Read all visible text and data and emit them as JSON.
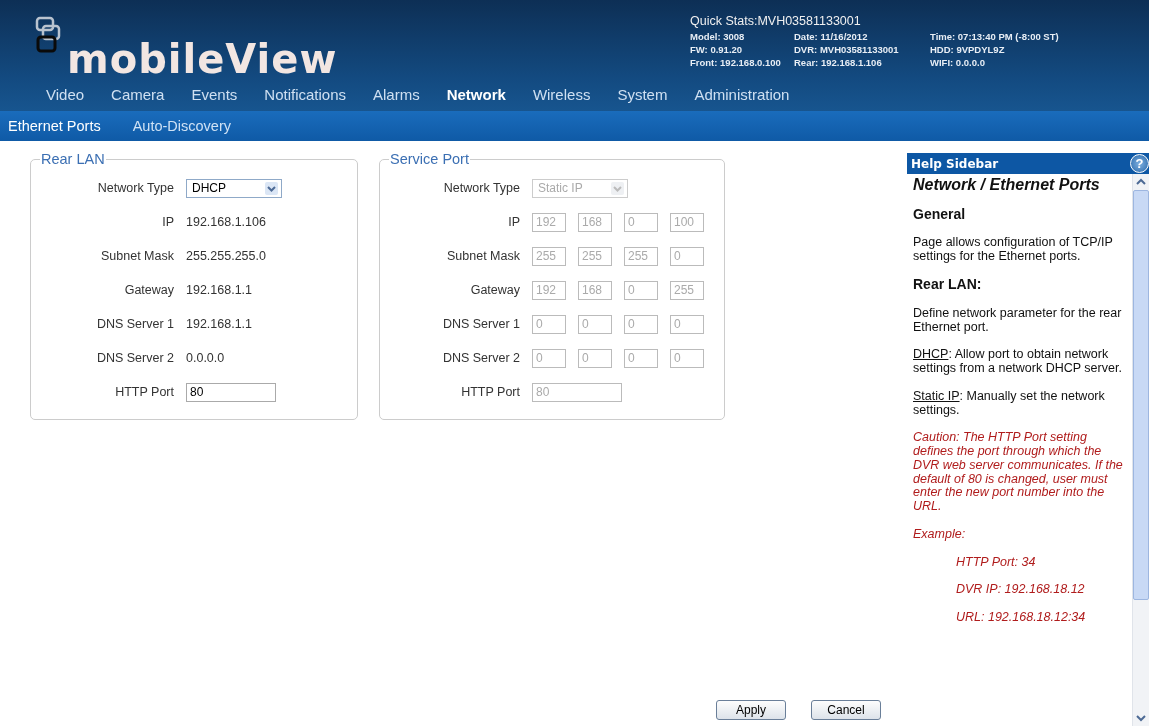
{
  "brand": "mobileView",
  "quick_stats": {
    "title": "Quick Stats:MVH03581133001",
    "items": [
      {
        "label": "Model:",
        "value": "3008"
      },
      {
        "label": "Date:",
        "value": "11/16/2012"
      },
      {
        "label": "Time:",
        "value": "07:13:40 PM (-8:00 ST)"
      },
      {
        "label": "FW:",
        "value": "0.91.20"
      },
      {
        "label": "DVR:",
        "value": "MVH03581133001"
      },
      {
        "label": "HDD:",
        "value": "9VPDYL9Z"
      },
      {
        "label": "Front:",
        "value": "192.168.0.100"
      },
      {
        "label": "Rear:",
        "value": "192.168.1.106"
      },
      {
        "label": "WIFI:",
        "value": "0.0.0.0"
      }
    ]
  },
  "nav": [
    {
      "label": "Video",
      "selected": false
    },
    {
      "label": "Camera",
      "selected": false
    },
    {
      "label": "Events",
      "selected": false
    },
    {
      "label": "Notifications",
      "selected": false
    },
    {
      "label": "Alarms",
      "selected": false
    },
    {
      "label": "Network",
      "selected": true
    },
    {
      "label": "Wireless",
      "selected": false
    },
    {
      "label": "System",
      "selected": false
    },
    {
      "label": "Administration",
      "selected": false
    }
  ],
  "subnav": [
    {
      "label": "Ethernet Ports",
      "selected": true
    },
    {
      "label": "Auto-Discovery",
      "selected": false
    }
  ],
  "sections": [
    {
      "title": "Rear LAN",
      "rows": [
        {
          "label": "Network Type",
          "kind": "select",
          "value": "DHCP",
          "disabled": false
        },
        {
          "label": "IP",
          "kind": "text",
          "value": "192.168.1.106"
        },
        {
          "label": "Subnet Mask",
          "kind": "text",
          "value": "255.255.255.0"
        },
        {
          "label": "Gateway",
          "kind": "text",
          "value": "192.168.1.1"
        },
        {
          "label": "DNS Server 1",
          "kind": "text",
          "value": "192.168.1.1"
        },
        {
          "label": "DNS Server 2",
          "kind": "text",
          "value": "0.0.0.0"
        },
        {
          "label": "HTTP Port",
          "kind": "input",
          "value": "80",
          "disabled": false
        }
      ]
    },
    {
      "title": "Service Port",
      "rows": [
        {
          "label": "Network Type",
          "kind": "select",
          "value": "Static IP",
          "disabled": true
        },
        {
          "label": "IP",
          "kind": "octets",
          "values": [
            "192",
            "168",
            "0",
            "100"
          ],
          "disabled": true
        },
        {
          "label": "Subnet Mask",
          "kind": "octets",
          "values": [
            "255",
            "255",
            "255",
            "0"
          ],
          "disabled": true
        },
        {
          "label": "Gateway",
          "kind": "octets",
          "values": [
            "192",
            "168",
            "0",
            "255"
          ],
          "disabled": true
        },
        {
          "label": "DNS Server 1",
          "kind": "octets",
          "values": [
            "0",
            "0",
            "0",
            "0"
          ],
          "disabled": true
        },
        {
          "label": "DNS Server 2",
          "kind": "octets",
          "values": [
            "0",
            "0",
            "0",
            "0"
          ],
          "disabled": true
        },
        {
          "label": "HTTP Port",
          "kind": "input",
          "value": "80",
          "disabled": true
        }
      ]
    }
  ],
  "buttons": [
    "Apply",
    "Cancel"
  ],
  "help": {
    "title": "Help Sidebar",
    "icon": "?",
    "heading": "Network / Ethernet Ports",
    "blocks": [
      {
        "kind": "heading",
        "text": "General"
      },
      {
        "kind": "para",
        "text": "Page allows configuration of TCP/IP settings for the Ethernet ports."
      },
      {
        "kind": "heading",
        "text": "Rear LAN:"
      },
      {
        "kind": "para",
        "text": "Define network parameter for the rear Ethernet port."
      },
      {
        "kind": "term",
        "term": "DHCP",
        "text": ": Allow port to obtain network settings from a network DHCP server."
      },
      {
        "kind": "term",
        "term": "Static IP",
        "text": ": Manually set the network settings."
      },
      {
        "kind": "caution",
        "text": "Caution: The HTTP Port setting defines the port through which the DVR web server communicates. If the default of 80 is changed, user must enter the new port number into the URL."
      },
      {
        "kind": "caution",
        "text": "Example:"
      },
      {
        "kind": "example",
        "text": "HTTP Port: 34"
      },
      {
        "kind": "example",
        "text": "DVR IP: 192.168.18.12"
      },
      {
        "kind": "example",
        "text": "URL: 192.168.18.12:34"
      }
    ]
  }
}
